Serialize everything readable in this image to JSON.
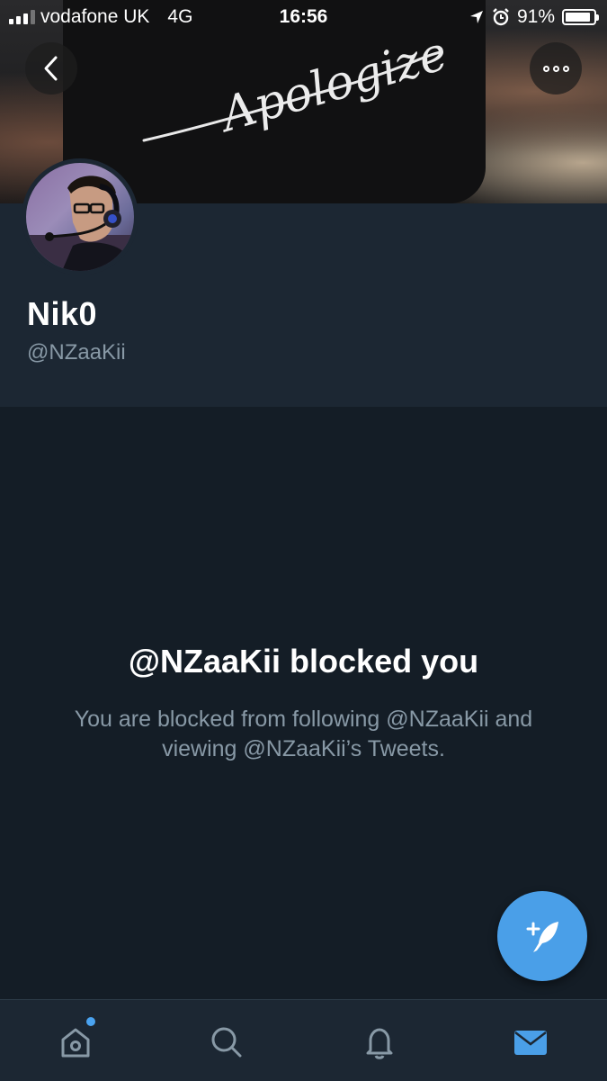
{
  "status_bar": {
    "carrier": "vodafone UK",
    "network": "4G",
    "time": "16:56",
    "battery": "91%",
    "battery_level": 0.91
  },
  "header": {
    "banner_text": "Apologize",
    "back_icon": "chevron-left-icon",
    "more_icon": "more-dots-icon"
  },
  "profile": {
    "display_name": "Nik0",
    "handle": "@NZaaKii"
  },
  "blocked": {
    "title": "@NZaaKii blocked you",
    "message": "You are blocked from following @NZaaKii and viewing @NZaaKii’s Tweets."
  },
  "compose": {
    "icon": "compose-quill-icon"
  },
  "tabbar": {
    "tabs": [
      {
        "id": "home",
        "icon": "home-icon",
        "has_badge": true
      },
      {
        "id": "search",
        "icon": "search-icon",
        "has_badge": false
      },
      {
        "id": "notifications",
        "icon": "bell-icon",
        "has_badge": false
      },
      {
        "id": "messages",
        "icon": "mail-icon",
        "active": true
      }
    ]
  },
  "colors": {
    "background": "#141d26",
    "panel": "#1c2733",
    "accent": "#4a9fe8",
    "secondary_text": "#8899a6"
  }
}
